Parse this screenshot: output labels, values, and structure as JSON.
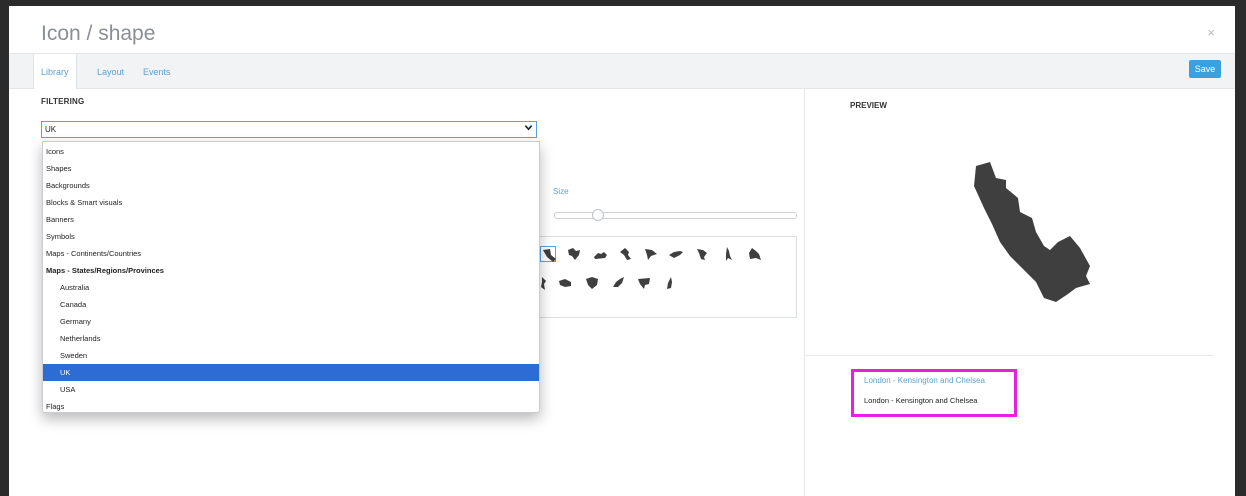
{
  "dialog": {
    "title": "Icon / shape",
    "close_glyph": "×"
  },
  "tabs": [
    {
      "label": "Library",
      "active": true
    },
    {
      "label": "Layout",
      "active": false
    },
    {
      "label": "Events",
      "active": false
    }
  ],
  "toolbar": {
    "save_label": "Save"
  },
  "filtering": {
    "heading": "FILTERING",
    "selected_value": "UK",
    "options": [
      {
        "label": "Icons",
        "type": "option"
      },
      {
        "label": "Shapes",
        "type": "option"
      },
      {
        "label": "Backgrounds",
        "type": "option"
      },
      {
        "label": "Blocks & Smart visuals",
        "type": "option"
      },
      {
        "label": "Banners",
        "type": "option"
      },
      {
        "label": "Symbols",
        "type": "option"
      },
      {
        "label": "Maps - Continents/Countries",
        "type": "option"
      },
      {
        "label": "Maps - States/Regions/Provinces",
        "type": "group"
      },
      {
        "label": "Australia",
        "type": "sub"
      },
      {
        "label": "Canada",
        "type": "sub"
      },
      {
        "label": "Germany",
        "type": "sub"
      },
      {
        "label": "Netherlands",
        "type": "sub"
      },
      {
        "label": "Sweden",
        "type": "sub"
      },
      {
        "label": "UK",
        "type": "sub",
        "selected": true
      },
      {
        "label": "USA",
        "type": "sub"
      },
      {
        "label": "Flags",
        "type": "option"
      }
    ]
  },
  "size": {
    "label": "Size",
    "level": 0.18
  },
  "library": {
    "shape_color": "#3f3f3f",
    "selected_index": 0,
    "thumbnail_count": 14
  },
  "preview": {
    "heading": "PREVIEW",
    "shape_link": "London - Kensington and Chelsea",
    "shape_name": "London - Kensington and Chelsea"
  },
  "colors": {
    "accent": "#5ba3d6",
    "save_button": "#3aa0de",
    "selected_option": "#2d6cd5",
    "highlight": "#e81ee0",
    "shape": "#3f3f3f"
  }
}
